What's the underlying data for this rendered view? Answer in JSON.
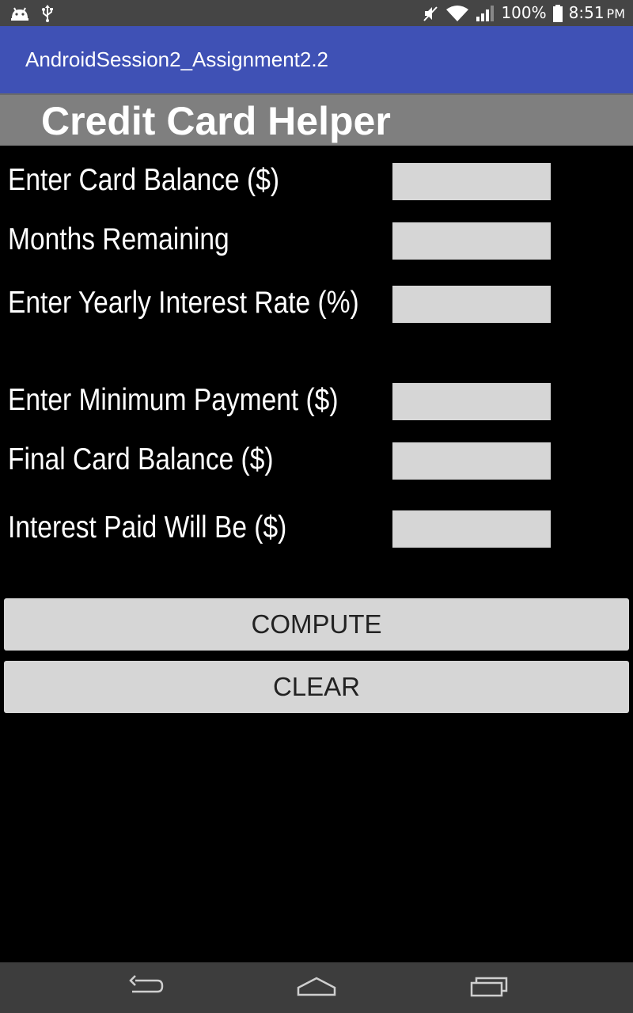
{
  "status_bar": {
    "battery": "100%",
    "time": "8:51",
    "ampm": "PM",
    "icons": [
      "android-debug-icon",
      "usb-icon",
      "mute-icon",
      "wifi-icon",
      "signal-icon",
      "battery-icon"
    ]
  },
  "action_bar": {
    "title": "AndroidSession2_Assignment2.2",
    "color": "#3f51b5"
  },
  "header": {
    "title": "Credit Card Helper",
    "background": "#7f7f7f"
  },
  "form": {
    "fields": [
      {
        "label": "Enter Card Balance ($)",
        "value": ""
      },
      {
        "label": "Months Remaining",
        "value": ""
      },
      {
        "label": "Enter Yearly Interest Rate (%)",
        "value": ""
      },
      {
        "label": "Enter Minimum Payment ($)",
        "value": ""
      },
      {
        "label": "Final Card Balance ($)",
        "value": ""
      },
      {
        "label": "Interest Paid Will Be ($)",
        "value": ""
      }
    ]
  },
  "buttons": {
    "compute": "COMPUTE",
    "clear": "CLEAR"
  },
  "nav_bar": {
    "icons": [
      "back-icon",
      "home-icon",
      "recent-apps-icon"
    ]
  }
}
